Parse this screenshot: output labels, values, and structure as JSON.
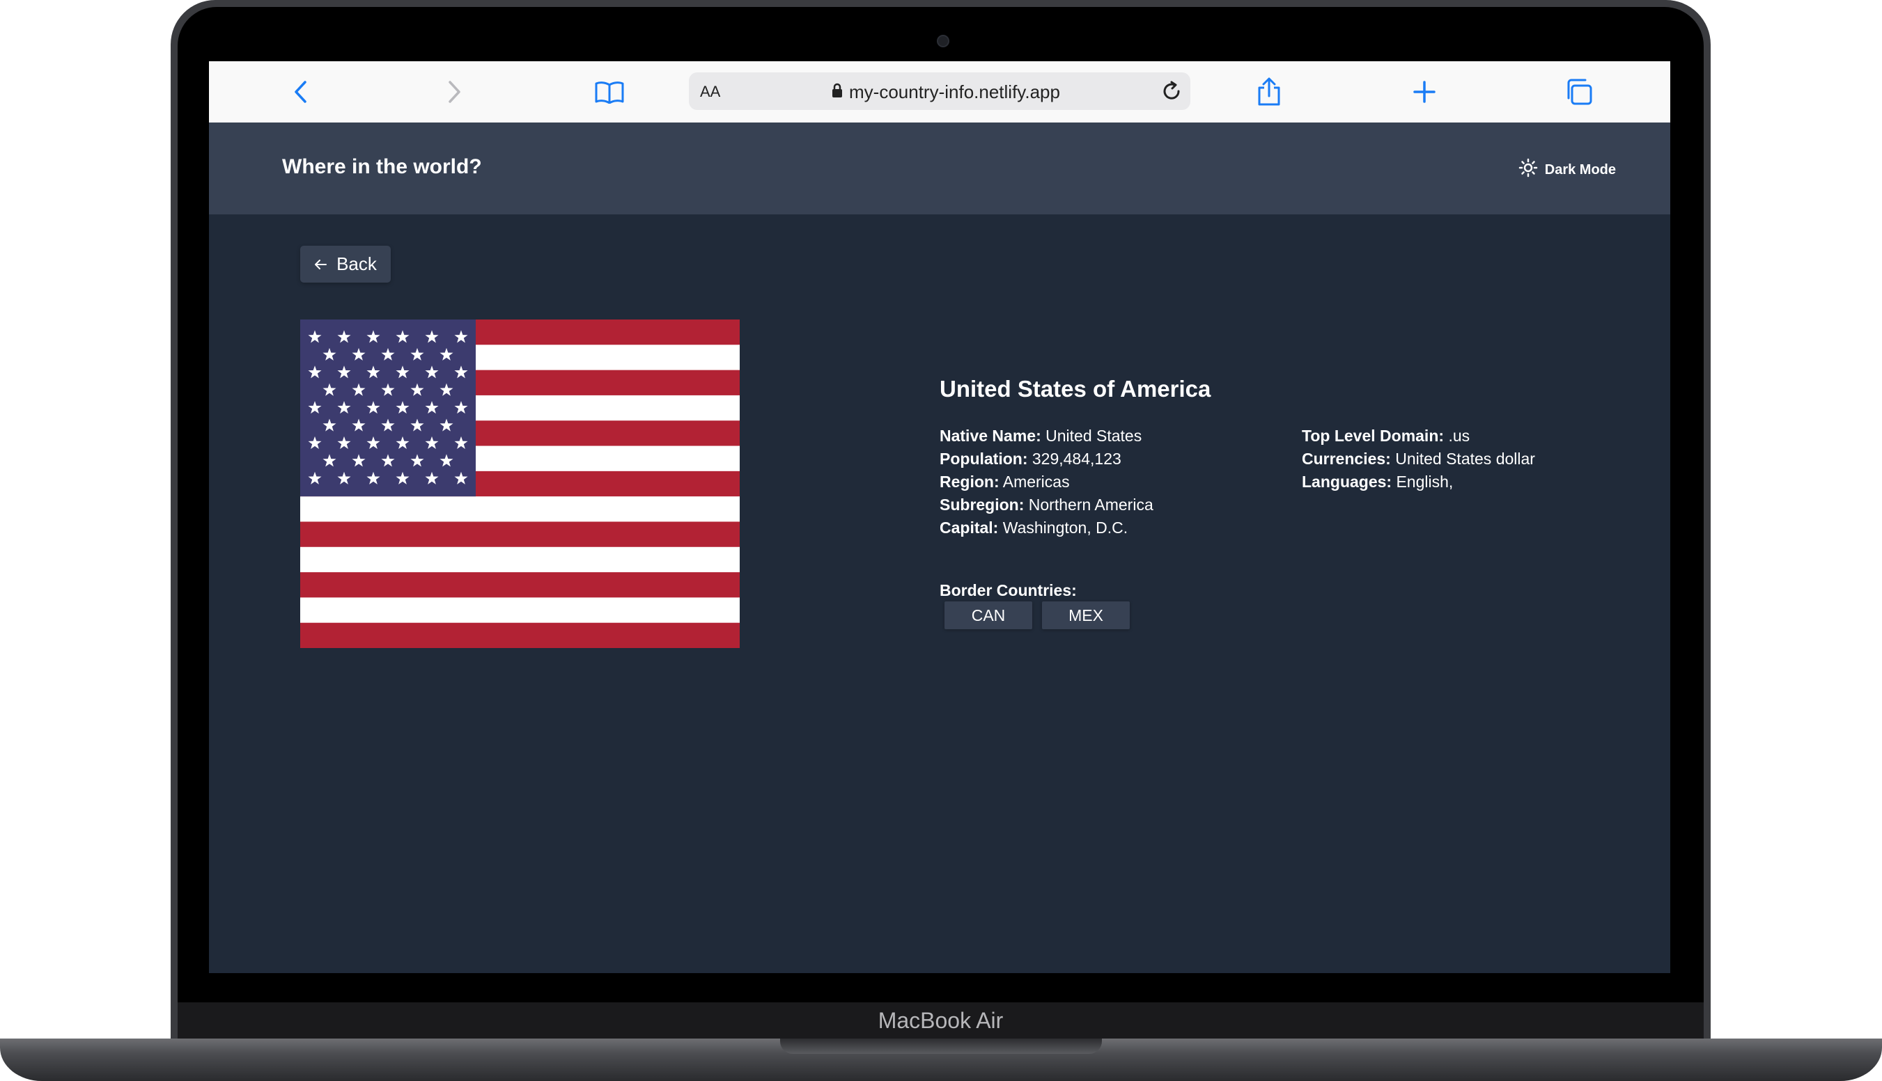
{
  "device": {
    "label": "MacBook Air"
  },
  "browser": {
    "text_size_label": "AA",
    "url": "my-country-info.netlify.app",
    "icons": [
      "back-icon",
      "forward-icon",
      "bookmarks-icon",
      "lock-icon",
      "reload-icon",
      "share-icon",
      "new-tab-icon",
      "tabs-icon"
    ]
  },
  "app": {
    "title": "Where in the world?",
    "theme_toggle": "Dark Mode",
    "colors": {
      "background": "#202a39",
      "element": "#374153",
      "text": "#ffffff"
    }
  },
  "back_button": {
    "label": "Back"
  },
  "country": {
    "name": "United States of America",
    "flag": "us-flag",
    "left_fields": [
      {
        "label": "Native Name:",
        "value": "United States"
      },
      {
        "label": "Population:",
        "value": "329,484,123"
      },
      {
        "label": "Region:",
        "value": "Americas"
      },
      {
        "label": "Subregion:",
        "value": "Northern America"
      },
      {
        "label": "Capital:",
        "value": "Washington, D.C."
      }
    ],
    "right_fields": [
      {
        "label": "Top Level Domain:",
        "value": ".us"
      },
      {
        "label": "Currencies:",
        "value": "United States dollar"
      },
      {
        "label": "Languages:",
        "value": "English,"
      }
    ],
    "border_label": "Border Countries:",
    "borders": [
      "CAN",
      "MEX"
    ]
  }
}
